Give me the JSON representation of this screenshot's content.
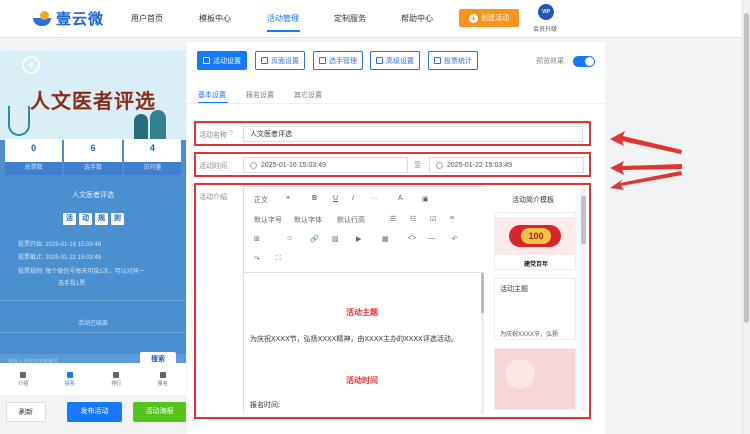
{
  "brand": {
    "name": "壹云微"
  },
  "nav": {
    "items": [
      "用户首页",
      "模板中心",
      "活动管理",
      "定制服务",
      "帮助中心"
    ],
    "create_label": "创建活动",
    "vip_badge": "VIP",
    "vip_label": "会员升级"
  },
  "preview": {
    "banner_title": "人文医者评选",
    "stats": [
      {
        "value": "0",
        "label": "总票数"
      },
      {
        "value": "6",
        "label": "选手数"
      },
      {
        "value": "4",
        "label": "访问量"
      }
    ],
    "activity_title": "人文医者评选",
    "rules": [
      "活",
      "动",
      "规",
      "则"
    ],
    "lines": [
      "投票开始: 2025-01-16 15:03:49",
      "投票截止: 2025-01-22 15:03:49",
      "投票规则: 每个微信号每天可投1次，可以对同一",
      "选手投1票"
    ],
    "intro_label": "活动已结束",
    "search_placeholder": "请输入选手名字或编号",
    "search_button": "搜索",
    "tabs": [
      "介绍",
      "投票",
      "排行",
      "报名"
    ]
  },
  "actions": {
    "refresh": "刷新",
    "publish": "发布活动",
    "live": "活动海报"
  },
  "toolbar": {
    "buttons": [
      "活动设置",
      "页面设置",
      "选手管理",
      "高级设置",
      "投票统计"
    ],
    "preview_label": "预览效果",
    "preview_on": true
  },
  "subtabs": [
    "基本设置",
    "报名设置",
    "其它设置"
  ],
  "form": {
    "name_label": "活动名称",
    "name_value": "人文医者评选",
    "time_label": "活动时间",
    "start": "2025-01-16 15:03:49",
    "to": "至",
    "end": "2025-01-22 15:03:49",
    "intro_label": "活动介绍"
  },
  "editor": {
    "tools_row1": [
      "正文",
      "❝",
      "B",
      "U",
      "I",
      "···",
      "A",
      "▣"
    ],
    "tools_row2": [
      "默认字号",
      "默认字体",
      "默认行高",
      "☰",
      "☷",
      "☑",
      "≡"
    ],
    "tools_row3": [
      "⊞",
      "☺",
      "🔗",
      "▨",
      "▶",
      "▦",
      "<>",
      "—",
      "↶"
    ],
    "tools_row4": [
      "↷",
      "⛶"
    ],
    "heading1": "活动主题",
    "para1": "为庆祝XXXX节，弘扬XXXX精神，由XXXX主办的XXXX评选活动。",
    "heading2": "活动时间",
    "para2": "报名时间:"
  },
  "template_panel": {
    "title": "活动简介模板",
    "card1_caption": "建党百年",
    "card2_title": "活动主题",
    "card2_text": "为庆祝XXXX节，弘扬"
  },
  "colors": {
    "accent": "#1677ff",
    "highlight": "#e23434",
    "orange": "#f7941d",
    "green": "#52c41a"
  }
}
